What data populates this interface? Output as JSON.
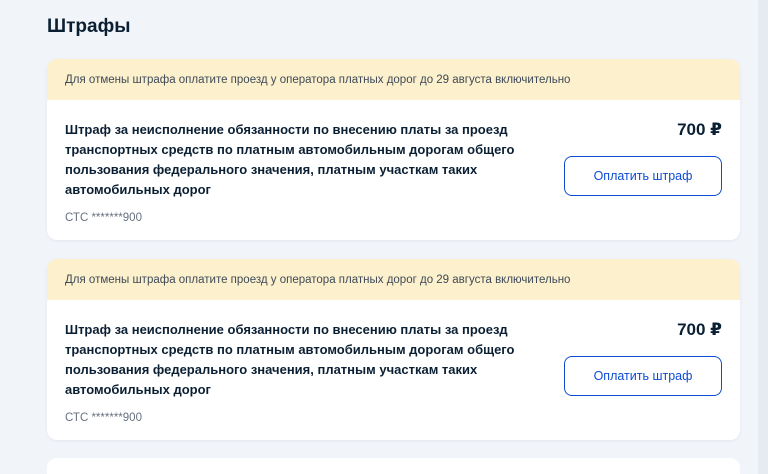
{
  "page": {
    "title": "Штрафы"
  },
  "fines": [
    {
      "notice": "Для отмены штрафа оплатите проезд у оператора платных дорог до 29 августа включительно",
      "description": "Штраф за неисполнение обязанности по внесению платы за проезд транспортных средств по платным автомобильным дорогам общего пользования федерального значения, платным участкам таких автомобильных дорог",
      "document": "СТС *******900",
      "amount": "700 ₽",
      "pay_label": "Оплатить штраф"
    },
    {
      "notice": "Для отмены штрафа оплатите проезд у оператора платных дорог до 29 августа включительно",
      "description": "Штраф за неисполнение обязанности по внесению платы за проезд транспортных средств по платным автомобильным дорогам общего пользования федерального значения, платным участкам таких автомобильных дорог",
      "document": "СТС *******900",
      "amount": "700 ₽",
      "pay_label": "Оплатить штраф"
    }
  ],
  "colors": {
    "accent": "#0d4cd3",
    "notice_bg": "#fdf0cc",
    "page_bg": "#f1f4f9"
  }
}
